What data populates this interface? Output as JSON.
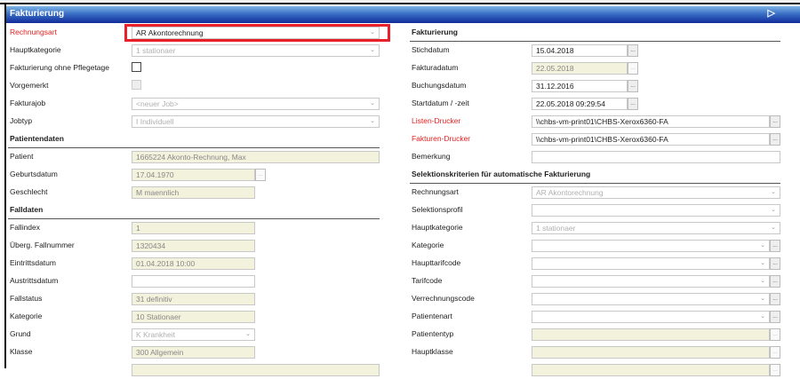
{
  "window": {
    "title": "Fakturierung"
  },
  "left": [
    {
      "label": "Rechnungsart",
      "required": true,
      "type": "select",
      "state": "enabled",
      "value": "AR Akontorechnung",
      "width": "full"
    },
    {
      "label": "Hauptkategorie",
      "type": "select",
      "state": "disabled",
      "value": "1 stationaer",
      "width": "full"
    },
    {
      "label": "Fakturierung ohne Pflegetage",
      "type": "checkbox",
      "state": "enabled",
      "checked": false
    },
    {
      "label": "Vorgemerkt",
      "type": "checkbox",
      "state": "disabled",
      "checked": false
    },
    {
      "label": "Fakturajob",
      "type": "select",
      "state": "disabled",
      "value": "<neuer Job>",
      "width": "full"
    },
    {
      "label": "Jobtyp",
      "type": "select",
      "state": "disabled",
      "value": "I Individuell",
      "width": "full"
    },
    {
      "section": "Patientendaten"
    },
    {
      "label": "Patient",
      "type": "input",
      "state": "readonly",
      "value": "1665224 Akonto-Rechnung, Max",
      "width": "full"
    },
    {
      "label": "Geburtsdatum",
      "type": "input-button",
      "state": "readonly",
      "value": "17.04.1970",
      "width": "short"
    },
    {
      "label": "Geschlecht",
      "type": "input",
      "state": "readonly",
      "value": "M maennlich",
      "width": "short"
    },
    {
      "section": "Falldaten"
    },
    {
      "label": "Fallindex",
      "type": "input",
      "state": "readonly",
      "value": "1",
      "width": "short"
    },
    {
      "label": "Überg. Fallnummer",
      "type": "input",
      "state": "readonly",
      "value": "1320434",
      "width": "short"
    },
    {
      "label": "Eintrittsdatum",
      "type": "input",
      "state": "readonly",
      "value": "01.04.2018 10:00",
      "width": "short"
    },
    {
      "label": "Austrittsdatum",
      "type": "input",
      "state": "enabled",
      "value": "",
      "width": "short"
    },
    {
      "label": "Fallstatus",
      "type": "input",
      "state": "readonly",
      "value": "31 definitiv",
      "width": "short"
    },
    {
      "label": "Kategorie",
      "type": "input",
      "state": "readonly",
      "value": "10 Stationaer",
      "width": "short"
    },
    {
      "label": "Grund",
      "type": "select",
      "state": "disabled",
      "value": "K Krankheit",
      "width": "short"
    },
    {
      "label": "Klasse",
      "type": "input",
      "state": "readonly",
      "value": "300 Allgemein",
      "width": "short"
    },
    {
      "label": "",
      "type": "input",
      "state": "readonly",
      "value": "",
      "width": "full"
    }
  ],
  "right": [
    {
      "section": "Fakturierung"
    },
    {
      "label": "Stichdatum",
      "type": "input-button",
      "state": "enabled",
      "value": "15.04.2018",
      "width": "date"
    },
    {
      "label": "Fakturadatum",
      "type": "input-button",
      "state": "readonly",
      "value": "22.05.2018",
      "width": "date"
    },
    {
      "label": "Buchungsdatum",
      "type": "input-button",
      "state": "enabled",
      "value": "31.12.2016",
      "width": "date"
    },
    {
      "label": "Startdatum / -zeit",
      "type": "input-button",
      "state": "enabled",
      "value": "22.05.2018 09:29:54",
      "width": "date"
    },
    {
      "label": "Listen-Drucker",
      "required": true,
      "type": "input-button",
      "state": "enabled",
      "value": "\\\\chbs-vm-print01\\CHBS-Xerox6360-FA",
      "width": "full"
    },
    {
      "label": "Fakturen-Drucker",
      "required": true,
      "type": "input-button",
      "state": "enabled",
      "value": "\\\\chbs-vm-print01\\CHBS-Xerox6360-FA",
      "width": "full"
    },
    {
      "label": "Bemerkung",
      "type": "input",
      "state": "enabled",
      "value": "",
      "width": "full"
    },
    {
      "section": "Selektionskriterien für automatische Fakturierung"
    },
    {
      "label": "Rechnungsart",
      "type": "select",
      "state": "disabled",
      "value": "AR Akontorechnung",
      "width": "full"
    },
    {
      "label": "Selektionsprofil",
      "type": "select",
      "state": "enabled",
      "value": "",
      "width": "full"
    },
    {
      "label": "Hauptkategorie",
      "type": "select",
      "state": "disabled",
      "value": "1 stationaer",
      "width": "full"
    },
    {
      "label": "Kategorie",
      "type": "select-button",
      "state": "enabled",
      "value": "",
      "width": "full"
    },
    {
      "label": "Haupttarifcode",
      "type": "select-button",
      "state": "enabled",
      "value": "",
      "width": "full"
    },
    {
      "label": "Tarifcode",
      "type": "select-button",
      "state": "enabled",
      "value": "",
      "width": "full"
    },
    {
      "label": "Verrechnungscode",
      "type": "select-button",
      "state": "enabled",
      "value": "",
      "width": "full"
    },
    {
      "label": "Patientenart",
      "type": "select-button",
      "state": "enabled",
      "value": "",
      "width": "full"
    },
    {
      "label": "Patiententyp",
      "type": "input-button",
      "state": "readonly",
      "value": "",
      "width": "full"
    },
    {
      "label": "Hauptklasse",
      "type": "input-button",
      "state": "readonly",
      "value": "",
      "width": "full"
    },
    {
      "label": "",
      "type": "input-button",
      "state": "readonly",
      "value": "",
      "width": "full"
    }
  ],
  "icons": {
    "chevron": "chevron-down-icon",
    "ellipsis": "..."
  }
}
